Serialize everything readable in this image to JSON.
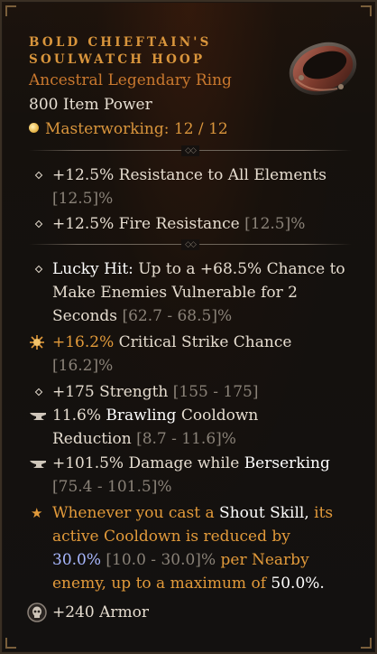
{
  "item": {
    "title_line1": "Bold Chieftain's",
    "title_line2": "Soulwatch Hoop",
    "type": "Ancestral Legendary Ring",
    "power": "800 Item Power",
    "masterworking": "Masterworking: 12 / 12"
  },
  "colors": {
    "title": "#d9953c",
    "legendary": "#c9782e",
    "range": "#8a8278",
    "keyword": "#ffffff",
    "aspect": "#e29a3a",
    "highlight": "#a9b8ff"
  },
  "implicits": [
    {
      "icon": "diamond-icon",
      "text": "+12.5% Resistance to All Elements",
      "range": "[12.5]%"
    },
    {
      "icon": "diamond-icon",
      "text": "+12.5% Fire Resistance",
      "range": "[12.5]%"
    }
  ],
  "affixes": {
    "lucky_hit": {
      "icon": "diamond-icon",
      "label": "Lucky Hit:",
      "line1_rest": "Up to a +68.5% Chance to",
      "line2": "Make Enemies Vulnerable for 2",
      "line3": "Seconds",
      "range": "[62.7 - 68.5]%"
    },
    "crit": {
      "icon": "greater-affix-sun-icon",
      "value": "+16.2%",
      "text": "Critical Strike Chance",
      "range": "[16.2]%"
    },
    "strength": {
      "icon": "diamond-icon",
      "text": "+175 Strength",
      "range": "[155 - 175]"
    },
    "brawling": {
      "icon": "tempered-anvil-icon",
      "prefix": "11.6%",
      "keyword": "Brawling",
      "rest": "Cooldown",
      "line2": "Reduction",
      "range": "[8.7 - 11.6]%"
    },
    "berserking": {
      "icon": "tempered-anvil-icon",
      "text": "+101.5% Damage while",
      "keyword": "Berserking",
      "range": "[75.4 - 101.5]%"
    }
  },
  "aspect": {
    "icon": "star-icon",
    "l1_a": "Whenever you cast a",
    "l1_kw1": "Shout",
    "l1_kw2": "Skill,",
    "l1_b": "its",
    "l2": "active Cooldown is reduced by",
    "l3_val": "30.0%",
    "l3_range": "[10.0 - 30.0]%",
    "l3_b": "per Nearby",
    "l4_a": "enemy, up to a maximum of",
    "l4_val": "50.0%."
  },
  "armor": {
    "icon": "skull-socket-icon",
    "text": "+240 Armor"
  }
}
